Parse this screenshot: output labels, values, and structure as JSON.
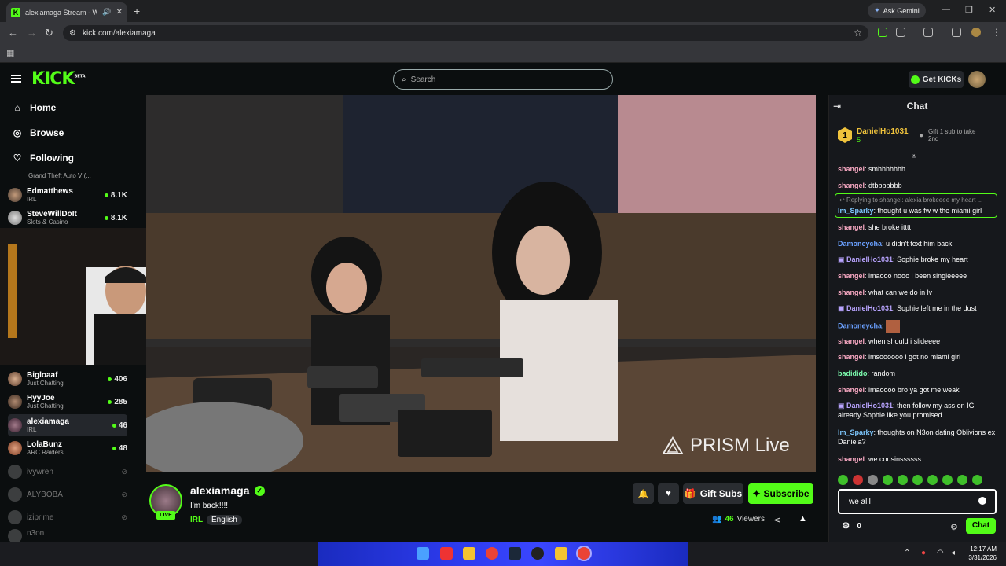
{
  "browser": {
    "tab_title": "alexiamaga Stream - Watch",
    "new_tab": "+",
    "ask_gemini": "Ask Gemini",
    "url": "kick.com/alexiamaga",
    "window_controls": [
      "—",
      "❐",
      "✕"
    ]
  },
  "header": {
    "logo": "KICK",
    "logo_badge": "BETA",
    "search_placeholder": "Search",
    "get_kicks": "Get KICKs"
  },
  "sidebar": {
    "nav": [
      {
        "label": "Home",
        "icon": "home-icon"
      },
      {
        "label": "Browse",
        "icon": "compass-icon"
      },
      {
        "label": "Following",
        "icon": "heart-icon"
      }
    ],
    "partial_category": "Grand Theft Auto V (...",
    "channels_top": [
      {
        "name": "Edmatthews",
        "category": "IRL",
        "viewers": "8.1K"
      },
      {
        "name": "SteveWillDoIt",
        "category": "Slots & Casino",
        "viewers": "8.1K"
      }
    ],
    "channels_bottom": [
      {
        "name": "Bigloaaf",
        "category": "Just Chatting",
        "viewers": "406"
      },
      {
        "name": "HyyJoe",
        "category": "Just Chatting",
        "viewers": "285"
      },
      {
        "name": "alexiamaga",
        "category": "IRL",
        "viewers": "46"
      },
      {
        "name": "LolaBunz",
        "category": "ARC Raiders",
        "viewers": "48"
      }
    ],
    "offline": [
      "ivywren",
      "ALYBOBA",
      "iziprime",
      "n3on"
    ]
  },
  "video": {
    "watermark": "PRISM Live"
  },
  "stream": {
    "name": "alexiamaga",
    "live": "LIVE",
    "title": "I'm back!!!!",
    "category": "IRL",
    "language": "English",
    "gift_subs": "Gift Subs",
    "subscribe": "Subscribe",
    "viewers_count": "46",
    "viewers_label": "Viewers"
  },
  "chat": {
    "title": "Chat",
    "pinned": {
      "rank": "1",
      "user": "DanielHo1031",
      "count": "5",
      "gift_text": "Gift 1 sub to take 2nd"
    },
    "reply_hint": "Replying to shangel: alexia brokeeee my heart ...",
    "messages": [
      {
        "user": "shangel",
        "color": "#f6a7c1",
        "text": "smhhhhhhh"
      },
      {
        "user": "shangel",
        "color": "#f6a7c1",
        "text": "dtbbbbbbb"
      },
      {
        "user": "Im_Sparky",
        "color": "#7ec8ff",
        "text": "thought u was fw w the miami girl"
      },
      {
        "user": "shangel",
        "color": "#f6a7c1",
        "text": "she broke itttt"
      },
      {
        "user": "Damoneycha",
        "color": "#6aa0ff",
        "text": "u didn't text him back"
      },
      {
        "user": "DanielHo1031",
        "color": "#b9a4ff",
        "text": "Sophie broke my heart"
      },
      {
        "user": "shangel",
        "color": "#f6a7c1",
        "text": "lmaooo nooo i been singleeeee"
      },
      {
        "user": "shangel",
        "color": "#f6a7c1",
        "text": "what can we do in lv"
      },
      {
        "user": "DanielHo1031",
        "color": "#b9a4ff",
        "text": "Sophie left me in the dust"
      },
      {
        "user": "Damoneycha",
        "color": "#6aa0ff",
        "text": ""
      },
      {
        "user": "shangel",
        "color": "#f6a7c1",
        "text": "when should i slideeee"
      },
      {
        "user": "shangel",
        "color": "#f6a7c1",
        "text": "lmsoooooo i got no miami girl"
      },
      {
        "user": "badidido",
        "color": "#7dffb0",
        "text": "random"
      },
      {
        "user": "shangel",
        "color": "#f6a7c1",
        "text": "lmaoooo bro ya got me weak"
      },
      {
        "user": "DanielHo1031",
        "color": "#b9a4ff",
        "text": "then follow my ass on IG already Sophie like you promised"
      },
      {
        "user": "Im_Sparky",
        "color": "#7ec8ff",
        "text": "thoughts on N3on dating Oblivions ex Daniela?"
      },
      {
        "user": "shangel",
        "color": "#f6a7c1",
        "text": "we cousinssssss"
      }
    ],
    "input_value": "we alll",
    "points": "0",
    "send": "Chat"
  },
  "taskbar": {
    "time": "12:17 AM",
    "date": "3/31/2026"
  },
  "colors": {
    "accent": "#53fc18",
    "bg": "#0b0e0f",
    "chat_bg": "#16181c"
  }
}
